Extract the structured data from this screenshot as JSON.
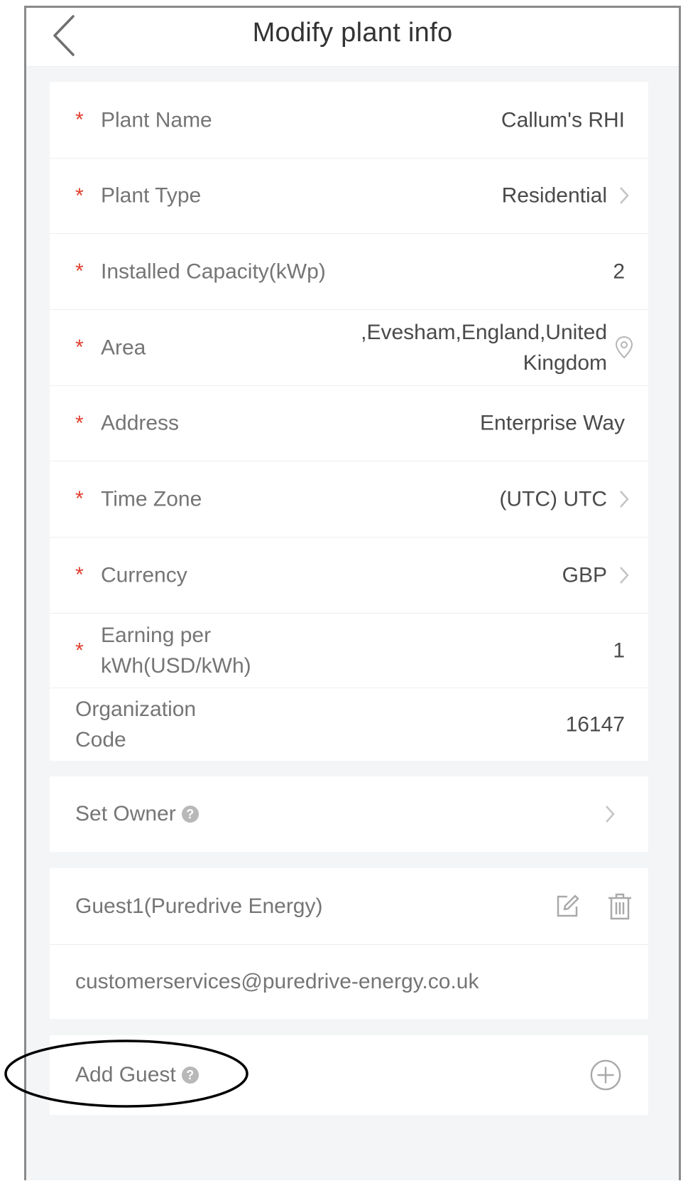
{
  "header": {
    "title": "Modify plant info"
  },
  "fields": [
    {
      "label": "Plant Name",
      "value": "Callum's RHI",
      "required": true,
      "arrow": false
    },
    {
      "label": "Plant Type",
      "value": "Residential",
      "required": true,
      "arrow": true
    },
    {
      "label": "Installed Capacity(kWp)",
      "value": "2",
      "required": true,
      "arrow": false
    },
    {
      "label": "Area",
      "value": ",Evesham,England,United Kingdom",
      "required": true,
      "arrow": false,
      "icon": "location-pin-icon"
    },
    {
      "label": "Address",
      "value": "Enterprise Way",
      "required": true,
      "arrow": false
    },
    {
      "label": "Time Zone",
      "value": "(UTC) UTC",
      "required": true,
      "arrow": true
    },
    {
      "label": "Currency",
      "value": "GBP",
      "required": true,
      "arrow": true
    },
    {
      "label": "Earning per kWh(USD/kWh)",
      "value": "1",
      "required": true,
      "arrow": false
    },
    {
      "label": "Organization Code",
      "value": "16147",
      "required": false,
      "arrow": false
    }
  ],
  "required_marker": "*",
  "owner": {
    "label": "Set Owner",
    "help_icon": "?"
  },
  "guest": {
    "name": "Guest1(Puredrive Energy)",
    "email": "customerservices@puredrive-energy.co.uk",
    "edit_icon": "edit-icon",
    "delete_icon": "trash-icon"
  },
  "add_guest": {
    "label": "Add Guest",
    "help_icon": "?",
    "add_icon": "plus-circle-icon"
  },
  "colors": {
    "required_star": "#e2412f",
    "annotation_ellipse": "#000000"
  }
}
